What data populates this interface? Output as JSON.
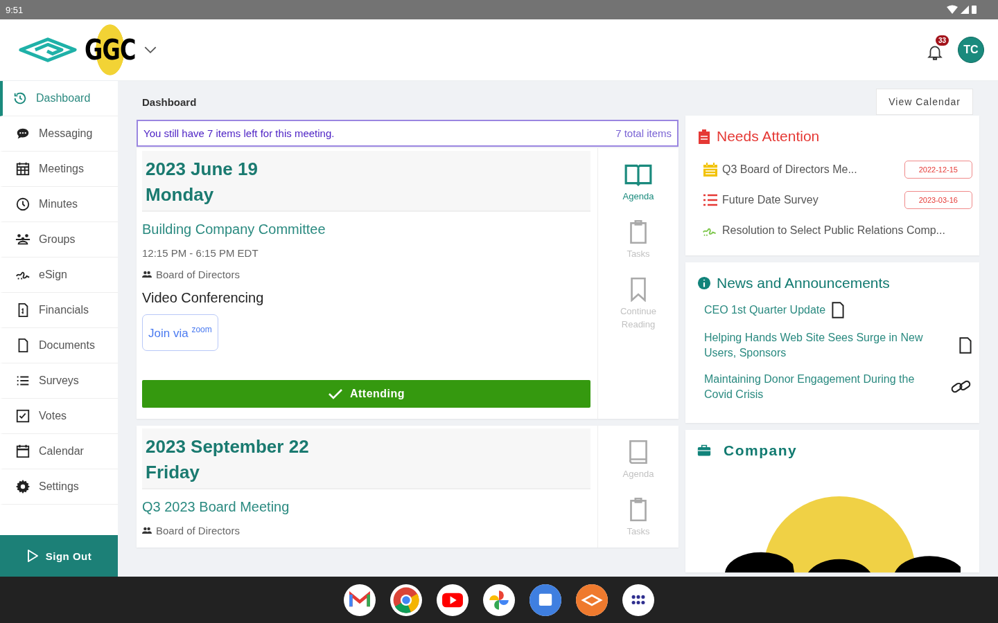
{
  "status_bar": {
    "time": "9:51"
  },
  "header": {
    "logo_text": "GGC",
    "notification_count": "33",
    "avatar_initials": "TC"
  },
  "sidebar": {
    "items": [
      {
        "label": "Dashboard",
        "kind": "history",
        "selected": true
      },
      {
        "label": "Messaging",
        "kind": "chat",
        "selected": false
      },
      {
        "label": "Meetings",
        "kind": "grid-calendar",
        "selected": false
      },
      {
        "label": "Minutes",
        "kind": "clock",
        "selected": false
      },
      {
        "label": "Groups",
        "kind": "people",
        "selected": false
      },
      {
        "label": "eSign",
        "kind": "signature",
        "selected": false
      },
      {
        "label": "Financials",
        "kind": "invoice",
        "selected": false
      },
      {
        "label": "Documents",
        "kind": "document",
        "selected": false
      },
      {
        "label": "Surveys",
        "kind": "list",
        "selected": false
      },
      {
        "label": "Votes",
        "kind": "checkbox",
        "selected": false
      },
      {
        "label": "Calendar",
        "kind": "calendar",
        "selected": false
      },
      {
        "label": "Settings",
        "kind": "gear",
        "selected": false
      }
    ],
    "sign_out": "Sign Out"
  },
  "page": {
    "breadcrumb": "Dashboard",
    "view_calendar": "View Calendar"
  },
  "notice": {
    "message": "You still have 7 items left for this meeting.",
    "total": "7 total items"
  },
  "meetings": [
    {
      "date": "2023 June 19",
      "weekday": "Monday",
      "title": "Building Company Committee",
      "time": "12:15 PM - 6:15 PM EDT",
      "group": "Board of Directors",
      "conferencing_heading": "Video Conferencing",
      "join_label": "Join via",
      "join_brand": "zoom",
      "attending": true,
      "attending_label": "Attending",
      "actions": [
        {
          "label": "Agenda",
          "kind": "book",
          "disabled": false
        },
        {
          "label": "Tasks",
          "kind": "clipboard",
          "disabled": true
        },
        {
          "label": "Continue Reading",
          "kind": "bookmark",
          "disabled": true
        }
      ]
    },
    {
      "date": "2023 September 22",
      "weekday": "Friday",
      "title": "Q3 2023 Board Meeting",
      "group": "Board of Directors",
      "actions": [
        {
          "label": "Agenda",
          "kind": "closed-book",
          "disabled": true
        },
        {
          "label": "Tasks",
          "kind": "clipboard",
          "disabled": true
        }
      ]
    }
  ],
  "needs_attention": {
    "title": "Needs Attention",
    "items": [
      {
        "kind": "meeting",
        "label": "Q3 Board of Directors Me...",
        "due": "2022-12-15"
      },
      {
        "kind": "survey",
        "label": "Future Date Survey",
        "due": "2023-03-16"
      },
      {
        "kind": "vote",
        "label": "Resolution to Select Public Relations Comp..."
      }
    ]
  },
  "news": {
    "title": "News and Announcements",
    "items": [
      {
        "kind": "document",
        "title": "CEO 1st Quarter Update"
      },
      {
        "kind": "document",
        "title": "Helping Hands Web Site Sees Surge in New Users, Sponsors"
      },
      {
        "kind": "link",
        "title": "Maintaining Donor Engagement During the Covid Crisis"
      }
    ]
  },
  "company": {
    "title": "Company"
  },
  "taskbar": {
    "apps": [
      {
        "kind": "envelope"
      },
      {
        "kind": "browser"
      },
      {
        "kind": "play"
      },
      {
        "kind": "pinwheel"
      },
      {
        "kind": "square"
      },
      {
        "kind": "diamond"
      },
      {
        "kind": "grid"
      }
    ]
  }
}
